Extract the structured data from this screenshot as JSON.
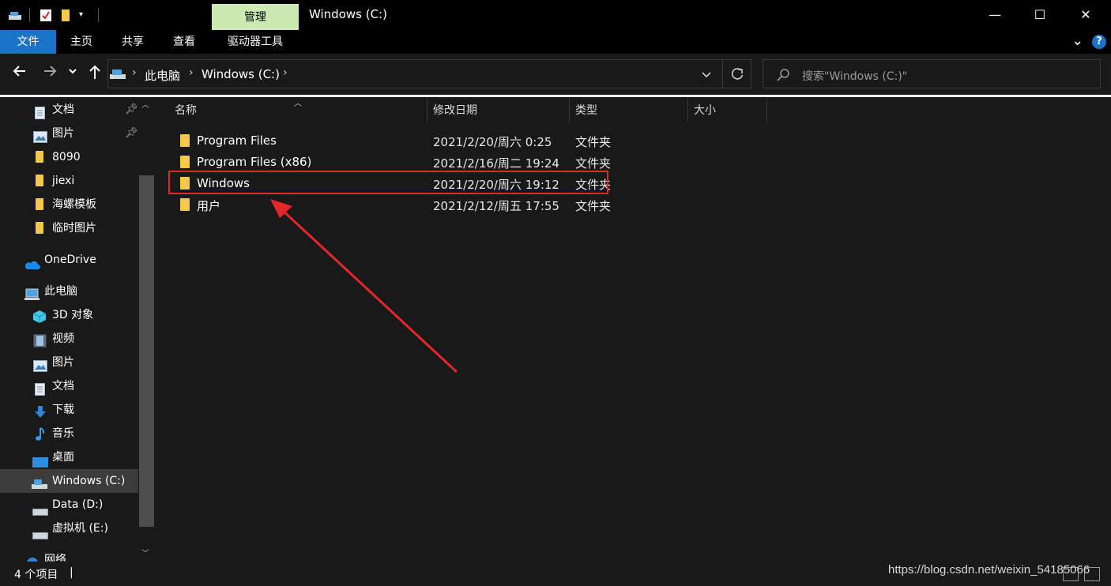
{
  "window": {
    "title": "Windows (C:)",
    "context_tab": "管理",
    "minimize_glyph": "—",
    "maximize_glyph": "☐",
    "close_glyph": "✕"
  },
  "ribbon": {
    "tabs": [
      "文件",
      "主页",
      "共享",
      "查看",
      "驱动器工具"
    ],
    "help_glyph": "?",
    "collapse_glyph": "⌄"
  },
  "address": {
    "crumbs": [
      "此电脑",
      "Windows (C:)"
    ],
    "search_placeholder": "搜索\"Windows (C:)\""
  },
  "nav": {
    "items": [
      {
        "label": "文档",
        "icon": "document-icon",
        "pinned": true
      },
      {
        "label": "图片",
        "icon": "pictures-icon",
        "pinned": true
      },
      {
        "label": "8090",
        "icon": "folder-icon"
      },
      {
        "label": "jiexi",
        "icon": "folder-icon"
      },
      {
        "label": "海螺模板",
        "icon": "folder-icon"
      },
      {
        "label": "临时图片",
        "icon": "folder-icon"
      },
      {
        "label": "OneDrive",
        "icon": "cloud-icon"
      },
      {
        "label": "此电脑",
        "icon": "computer-icon"
      },
      {
        "label": "3D 对象",
        "icon": "cube-icon"
      },
      {
        "label": "视频",
        "icon": "video-icon"
      },
      {
        "label": "图片",
        "icon": "pictures-icon"
      },
      {
        "label": "文档",
        "icon": "document-icon"
      },
      {
        "label": "下载",
        "icon": "download-icon"
      },
      {
        "label": "音乐",
        "icon": "music-icon"
      },
      {
        "label": "桌面",
        "icon": "desktop-icon"
      },
      {
        "label": "Windows (C:)",
        "icon": "drive-icon",
        "selected": true
      },
      {
        "label": "Data (D:)",
        "icon": "drive-icon"
      },
      {
        "label": "虚拟机 (E:)",
        "icon": "drive-icon"
      },
      {
        "label": "网络",
        "icon": "network-icon"
      }
    ]
  },
  "columns": [
    "名称",
    "修改日期",
    "类型",
    "大小"
  ],
  "files": [
    {
      "name": "Program Files",
      "date": "2021/2/20/周六 0:25",
      "type": "文件夹"
    },
    {
      "name": "Program Files (x86)",
      "date": "2021/2/16/周二 19:24",
      "type": "文件夹"
    },
    {
      "name": "Windows",
      "date": "2021/2/20/周六 19:12",
      "type": "文件夹",
      "highlighted": true
    },
    {
      "name": "用户",
      "date": "2021/2/12/周五 17:55",
      "type": "文件夹"
    }
  ],
  "status": {
    "count": "4 个项目",
    "separator": "|"
  },
  "watermark": "https://blog.csdn.net/weixin_54185066",
  "colors": {
    "accent": "#1a73c9",
    "context_tab": "#cbe9b3",
    "folder": "#f5c84c",
    "annotation_red": "#e5262a"
  }
}
